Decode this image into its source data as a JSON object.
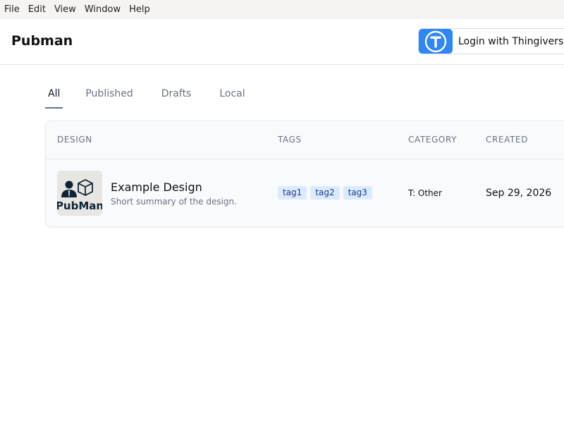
{
  "menubar": {
    "items": [
      "File",
      "Edit",
      "View",
      "Window",
      "Help"
    ]
  },
  "header": {
    "title": "Pubman",
    "login_label": "Login with Thingiverse"
  },
  "tabs": [
    {
      "label": "All",
      "active": true
    },
    {
      "label": "Published",
      "active": false
    },
    {
      "label": "Drafts",
      "active": false
    },
    {
      "label": "Local",
      "active": false
    }
  ],
  "table": {
    "columns": [
      "DESIGN",
      "TAGS",
      "CATEGORY",
      "CREATED"
    ],
    "rows": [
      {
        "thumbnail_text": "PubMan",
        "name": "Example Design",
        "summary": "Short summary of the design.",
        "tags": [
          "tag1",
          "tag2",
          "tag3"
        ],
        "category": "T: Other",
        "created": "Sep 29, 2026"
      }
    ]
  },
  "colors": {
    "accent": "#2f86f6",
    "tag_bg": "#dbeafe",
    "tag_text": "#1e3a8a"
  }
}
